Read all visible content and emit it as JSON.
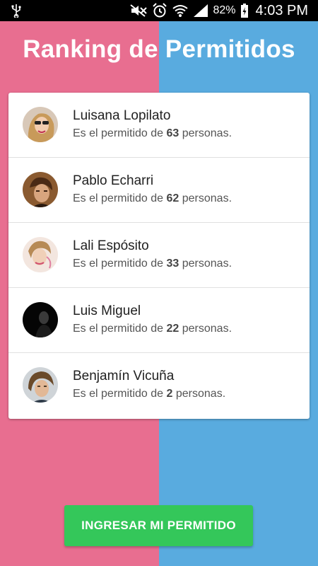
{
  "status_bar": {
    "battery_percent": "82%",
    "time": "4:03 PM",
    "icons": [
      "usb-icon",
      "mute-icon",
      "alarm-icon",
      "wifi-icon",
      "signal-icon",
      "battery-charging-icon"
    ]
  },
  "title": {
    "part1": "Ranking de ",
    "part2": "Permitidos"
  },
  "ranking": [
    {
      "name": "Luisana Lopilato",
      "prefix": "Es el permitido de ",
      "count": "63",
      "suffix": " personas."
    },
    {
      "name": "Pablo Echarri",
      "prefix": "Es el permitido de ",
      "count": "62",
      "suffix": " personas."
    },
    {
      "name": "Lali Espósito",
      "prefix": "Es el permitido de ",
      "count": "33",
      "suffix": " personas."
    },
    {
      "name": "Luis Miguel",
      "prefix": "Es el permitido de ",
      "count": "22",
      "suffix": " personas."
    },
    {
      "name": "Benjamín Vicuña",
      "prefix": "Es el permitido de ",
      "count": "2",
      "suffix": " personas."
    }
  ],
  "cta": {
    "label": "INGRESAR MI PERMITIDO"
  },
  "colors": {
    "left_panel": "#E86E90",
    "right_panel": "#59ABDF",
    "button": "#34C75A"
  }
}
